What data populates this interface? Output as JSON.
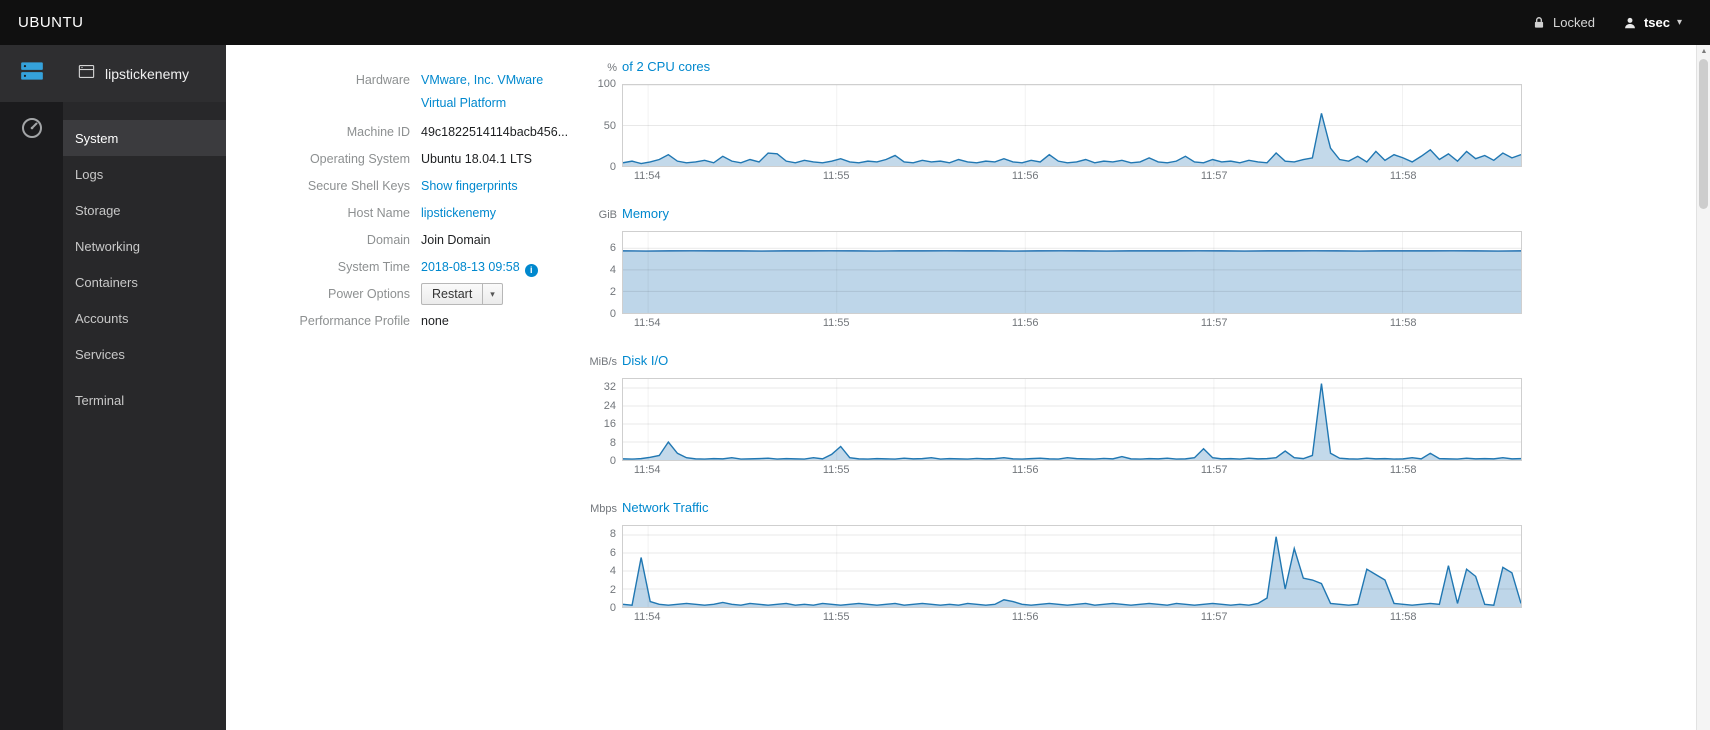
{
  "topbar": {
    "brand": "UBUNTU",
    "lock_label": "Locked",
    "user": "tsec"
  },
  "sidebar": {
    "host": "lipstickenemy",
    "items": [
      {
        "label": "System",
        "active": true
      },
      {
        "label": "Logs",
        "active": false
      },
      {
        "label": "Storage",
        "active": false
      },
      {
        "label": "Networking",
        "active": false
      },
      {
        "label": "Containers",
        "active": false
      },
      {
        "label": "Accounts",
        "active": false
      },
      {
        "label": "Services",
        "active": false
      },
      {
        "label": "Terminal",
        "active": false
      }
    ]
  },
  "info": {
    "rows": [
      {
        "label": "Hardware",
        "line1": "VMware, Inc. VMware",
        "line2": "Virtual Platform"
      },
      {
        "label": "Machine ID",
        "value": "49c1822514114bacb456..."
      },
      {
        "label": "Operating System",
        "value": "Ubuntu 18.04.1 LTS"
      },
      {
        "label": "Secure Shell Keys",
        "value": "Show fingerprints"
      },
      {
        "label": "Host Name",
        "value": "lipstickenemy"
      },
      {
        "label": "Domain",
        "value": "Join Domain"
      },
      {
        "label": "System Time",
        "value": "2018-08-13 09:58"
      },
      {
        "label": "Power Options",
        "value": "Restart"
      },
      {
        "label": "Performance Profile",
        "value": "none"
      }
    ]
  },
  "chart_data": [
    {
      "type": "area",
      "unit": "%",
      "title": "of 2 CPU cores",
      "ylim": [
        0,
        100
      ],
      "yticks": [
        100,
        50,
        0
      ],
      "xticks": [
        "11:54",
        "11:55",
        "11:56",
        "11:57",
        "11:58"
      ],
      "color": "#2077b2",
      "fill": "rgba(40,119,181,0.28)",
      "values": [
        4,
        6,
        3,
        5,
        8,
        14,
        6,
        4,
        5,
        7,
        4,
        12,
        6,
        4,
        8,
        5,
        16,
        15,
        6,
        4,
        7,
        5,
        4,
        6,
        9,
        5,
        4,
        6,
        5,
        8,
        13,
        5,
        4,
        7,
        5,
        6,
        4,
        8,
        5,
        4,
        6,
        5,
        9,
        5,
        4,
        7,
        5,
        14,
        6,
        4,
        5,
        8,
        4,
        6,
        5,
        7,
        4,
        5,
        10,
        5,
        4,
        6,
        12,
        5,
        4,
        8,
        5,
        6,
        4,
        7,
        5,
        4,
        16,
        6,
        5,
        8,
        10,
        65,
        22,
        8,
        6,
        12,
        5,
        18,
        7,
        14,
        10,
        5,
        12,
        20,
        8,
        15,
        6,
        18,
        9,
        13,
        7,
        16,
        10,
        14
      ]
    },
    {
      "type": "area",
      "unit": "GiB",
      "title": "Memory",
      "ylim": [
        0,
        7.5
      ],
      "yticks": [
        6,
        4,
        2,
        0
      ],
      "xticks": [
        "11:54",
        "11:55",
        "11:56",
        "11:57",
        "11:58"
      ],
      "color": "#1f6fb0",
      "fill": "rgba(40,119,181,0.30)",
      "values": [
        5.75,
        5.74,
        5.75,
        5.76,
        5.75,
        5.75,
        5.74,
        5.75,
        5.75,
        5.76,
        5.75,
        5.74,
        5.75,
        5.75,
        5.76,
        5.75,
        5.75,
        5.74,
        5.75,
        5.76,
        5.75,
        5.74,
        5.75,
        5.75,
        5.75,
        5.76,
        5.75,
        5.74,
        5.75,
        5.75,
        5.76,
        5.75,
        5.74,
        5.75,
        5.75,
        5.75,
        5.76,
        5.75,
        5.74,
        5.75
      ]
    },
    {
      "type": "area",
      "unit": "MiB/s",
      "title": "Disk I/O",
      "ylim": [
        0,
        36
      ],
      "yticks": [
        32,
        24,
        16,
        8,
        0
      ],
      "xticks": [
        "11:54",
        "11:55",
        "11:56",
        "11:57",
        "11:58"
      ],
      "color": "#2077b2",
      "fill": "rgba(40,119,181,0.28)",
      "values": [
        0.5,
        0.4,
        0.6,
        1.2,
        2,
        8,
        3,
        1,
        0.5,
        0.4,
        0.6,
        0.5,
        1,
        0.4,
        0.5,
        0.6,
        0.8,
        0.4,
        0.6,
        0.5,
        0.4,
        1,
        0.5,
        2.5,
        6,
        1,
        0.5,
        0.4,
        0.6,
        0.5,
        0.4,
        0.8,
        0.5,
        0.6,
        1,
        0.4,
        0.6,
        0.5,
        0.4,
        0.7,
        0.5,
        0.6,
        1,
        0.5,
        0.4,
        0.6,
        0.8,
        0.5,
        0.4,
        1,
        0.6,
        0.5,
        0.4,
        0.7,
        0.5,
        1.5,
        0.5,
        0.4,
        0.6,
        0.5,
        0.8,
        0.4,
        0.5,
        1,
        5,
        1,
        0.5,
        0.6,
        0.4,
        0.8,
        0.5,
        0.6,
        1,
        4,
        1,
        0.6,
        2,
        34,
        3,
        0.8,
        0.5,
        0.4,
        0.8,
        0.5,
        0.6,
        0.4,
        0.5,
        1,
        0.5,
        3,
        0.6,
        0.5,
        0.4,
        0.8,
        0.5,
        0.6,
        0.5,
        1,
        0.5,
        0.6
      ]
    },
    {
      "type": "area",
      "unit": "Mbps",
      "title": "Network Traffic",
      "ylim": [
        0,
        9
      ],
      "yticks": [
        8,
        6,
        4,
        2,
        0
      ],
      "xticks": [
        "11:54",
        "11:55",
        "11:56",
        "11:57",
        "11:58"
      ],
      "color": "#2077b2",
      "fill": "rgba(40,119,181,0.30)",
      "values": [
        0.3,
        0.2,
        5.5,
        0.6,
        0.3,
        0.2,
        0.3,
        0.4,
        0.3,
        0.2,
        0.3,
        0.5,
        0.3,
        0.2,
        0.4,
        0.3,
        0.2,
        0.3,
        0.4,
        0.2,
        0.3,
        0.2,
        0.4,
        0.3,
        0.2,
        0.3,
        0.4,
        0.3,
        0.2,
        0.3,
        0.4,
        0.2,
        0.3,
        0.4,
        0.3,
        0.2,
        0.3,
        0.2,
        0.4,
        0.3,
        0.2,
        0.3,
        0.8,
        0.6,
        0.3,
        0.2,
        0.3,
        0.4,
        0.3,
        0.2,
        0.3,
        0.4,
        0.2,
        0.3,
        0.4,
        0.3,
        0.2,
        0.3,
        0.4,
        0.3,
        0.2,
        0.4,
        0.3,
        0.2,
        0.3,
        0.4,
        0.3,
        0.2,
        0.3,
        0.2,
        0.4,
        1,
        7.8,
        2,
        6.5,
        3.2,
        3,
        2.6,
        0.4,
        0.3,
        0.2,
        0.3,
        4.2,
        3.6,
        3,
        0.4,
        0.3,
        0.2,
        0.3,
        0.4,
        0.3,
        4.6,
        0.4,
        4.2,
        3.4,
        0.3,
        0.2,
        4.4,
        3.8,
        0.4
      ]
    }
  ]
}
